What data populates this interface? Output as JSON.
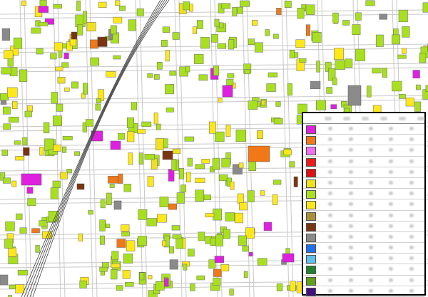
{
  "map": {
    "type": "zoning-land-use",
    "background": "#ffffff",
    "road_color": "#c8c8c8",
    "railway_color": "#444444"
  },
  "legend": {
    "title": "",
    "categories": [
      {
        "id": "c1",
        "color": "#e020e0"
      },
      {
        "id": "c2",
        "color": "#f07818"
      },
      {
        "id": "c3",
        "color": "#f070f0"
      },
      {
        "id": "c4",
        "color": "#f01818"
      },
      {
        "id": "c5",
        "color": "#e01010"
      },
      {
        "id": "c6",
        "color": "#f0e020"
      },
      {
        "id": "c7",
        "color": "#a8e020"
      },
      {
        "id": "c8",
        "color": "#ffe81a"
      },
      {
        "id": "c9",
        "color": "#a89038"
      },
      {
        "id": "c10",
        "color": "#7a3410"
      },
      {
        "id": "c11",
        "color": "#8a8a8a"
      },
      {
        "id": "c12",
        "color": "#1e70f0"
      },
      {
        "id": "c13",
        "color": "#60c0f0"
      },
      {
        "id": "c14",
        "color": "#208030"
      },
      {
        "id": "c15",
        "color": "#60a018"
      },
      {
        "id": "c16",
        "color": "#401080"
      }
    ]
  }
}
